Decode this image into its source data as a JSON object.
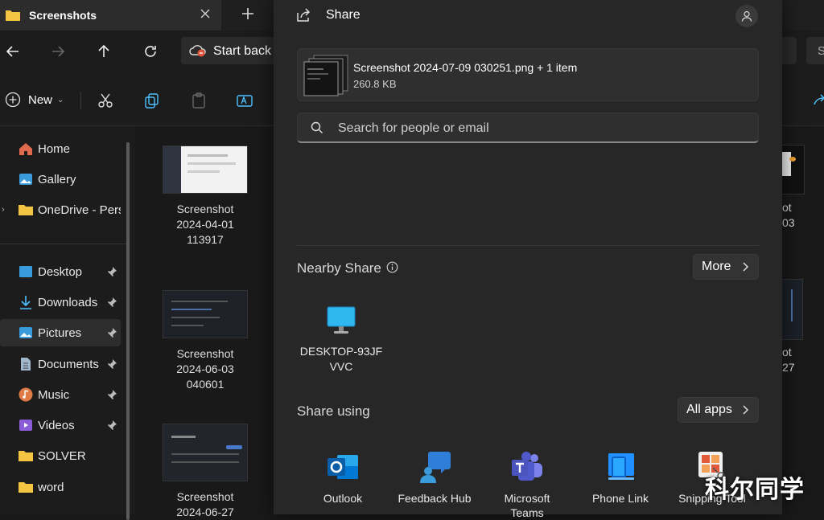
{
  "explorer": {
    "tab_title": "Screenshots",
    "address_text": "Start back",
    "search_hint": "S",
    "new_label": "New",
    "sidebar": {
      "items": [
        {
          "label": "Home"
        },
        {
          "label": "Gallery"
        },
        {
          "label": "OneDrive - Perso"
        },
        {
          "label": "Desktop"
        },
        {
          "label": "Downloads"
        },
        {
          "label": "Pictures"
        },
        {
          "label": "Documents"
        },
        {
          "label": "Music"
        },
        {
          "label": "Videos"
        },
        {
          "label": "SOLVER"
        },
        {
          "label": "word"
        }
      ]
    },
    "files": [
      {
        "line1": "Screenshot",
        "line2": "2024-04-01",
        "line3": "113917"
      },
      {
        "line1": "Screenshot",
        "line2": "2024-06-03",
        "line3": "040601"
      },
      {
        "line1": "Screenshot",
        "line2": "2024-06-27"
      }
    ],
    "partial_files": [
      {
        "line1": "ot",
        "line2": "03"
      },
      {
        "line1": "ot",
        "line2": "27"
      }
    ]
  },
  "share": {
    "title": "Share",
    "file": {
      "name": "Screenshot 2024-07-09 030251.png + 1 item",
      "size": "260.8 KB"
    },
    "search_placeholder": "Search for people or email",
    "nearby": {
      "title": "Nearby Share",
      "more_label": "More",
      "device_line1": "DESKTOP-93JF",
      "device_line2": "VVC"
    },
    "share_using": {
      "title": "Share using",
      "all_apps_label": "All apps",
      "apps": [
        {
          "name": "Outlook"
        },
        {
          "name": "Feedback Hub"
        },
        {
          "name": "Microsoft",
          "name2": "Teams"
        },
        {
          "name": "Phone Link"
        },
        {
          "name": "Snipping Tool"
        }
      ]
    }
  },
  "watermark": "科尔同学",
  "colors": {
    "accent_blue": "#4cc2ff",
    "folder_yellow": "#f4c542",
    "dialog_bg": "#272727"
  }
}
